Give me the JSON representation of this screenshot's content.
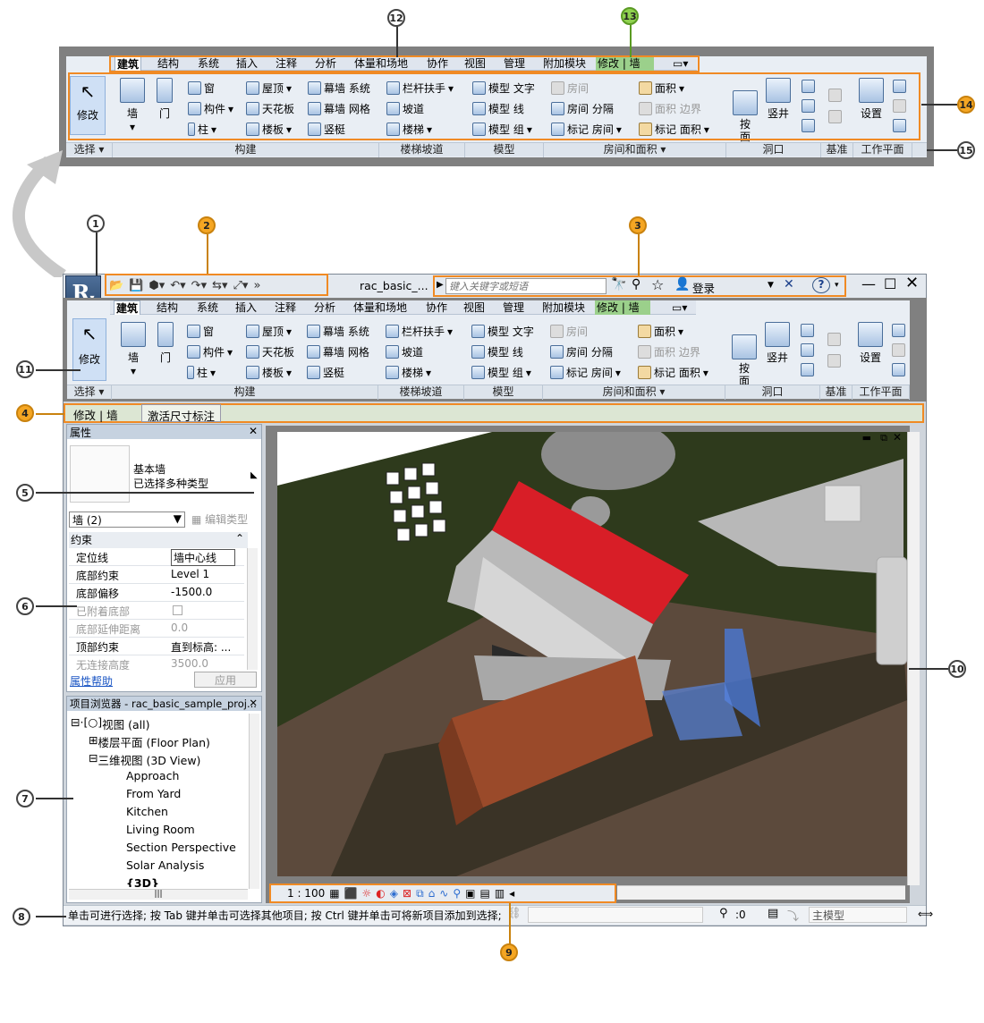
{
  "callouts": [
    "1",
    "2",
    "3",
    "4",
    "5",
    "6",
    "7",
    "8",
    "9",
    "10",
    "11",
    "12",
    "13",
    "14",
    "15"
  ],
  "ribbon": {
    "tabs": [
      "建筑",
      "结构",
      "系统",
      "插入",
      "注释",
      "分析",
      "体量和场地",
      "协作",
      "视图",
      "管理",
      "附加模块",
      "修改 | 墙"
    ],
    "tab_menu_icon": "tab-menu-icon",
    "modify": "修改",
    "build": {
      "wall": "墙",
      "door": "门",
      "window": "窗",
      "component": "构件",
      "column": "柱",
      "roof": "屋顶",
      "ceiling": "天花板",
      "floor": "楼板",
      "curtain_system": "幕墙 系统",
      "curtain_grid": "幕墙 网格",
      "mullion": "竖梃"
    },
    "stairs": {
      "railing": "栏杆扶手",
      "ramp": "坡道",
      "stair": "楼梯"
    },
    "model": {
      "text": "模型 文字",
      "line": "模型 线",
      "group": "模型 组"
    },
    "room": {
      "room": "房间",
      "room_sep": "房间 分隔",
      "tag_room": "标记 房间",
      "area": "面积",
      "area_boundary": "面积 边界",
      "tag_area": "标记 面积"
    },
    "opening": {
      "by_face": "按\n面",
      "shaft": "竖井"
    },
    "workplane": {
      "set": "设置"
    },
    "panels": {
      "select": "选择",
      "build": "构建",
      "stairs": "楼梯坡道",
      "model": "模型",
      "room": "房间和面积",
      "opening": "洞口",
      "datum": "基准",
      "workplane": "工作平面"
    }
  },
  "titlebar": {
    "filename": "rac_basic_...",
    "search_placeholder": "键入关键字或短语",
    "login": "登录",
    "help": "?"
  },
  "options_bar": {
    "context": "修改 | 墙",
    "button": "激活尺寸标注"
  },
  "properties": {
    "title": "属性",
    "type_name": "基本墙",
    "type_sub": "已选择多种类型",
    "selector": "墙 (2)",
    "edit_type": "编辑类型",
    "group": "约束",
    "rows": [
      {
        "name": "定位线",
        "value": "墙中心线",
        "dim": false
      },
      {
        "name": "底部约束",
        "value": "Level 1",
        "dim": false
      },
      {
        "name": "底部偏移",
        "value": "-1500.0",
        "dim": false
      },
      {
        "name": "已附着底部",
        "value": "",
        "dim": true
      },
      {
        "name": "底部延伸距离",
        "value": "0.0",
        "dim": true
      },
      {
        "name": "顶部约束",
        "value": "直到标高: ...",
        "dim": false
      },
      {
        "name": "无连接高度",
        "value": "3500.0",
        "dim": true
      }
    ],
    "help": "属性帮助",
    "apply": "应用"
  },
  "browser": {
    "title": "项目浏览器 - rac_basic_sample_proj...",
    "root": "视图 (all)",
    "floor": "楼层平面 (Floor Plan)",
    "view3d": "三维视图 (3D View)",
    "items": [
      "Approach",
      "From Yard",
      "Kitchen",
      "Living Room",
      "Section Perspective",
      "Solar Analysis",
      "{3D}"
    ]
  },
  "viewbar": {
    "scale": "1 : 100"
  },
  "status": {
    "message": "单击可进行选择; 按 Tab 键并单击可选择其他项目; 按 Ctrl 键并单击可将新项目添加到选择;",
    "count": ":0",
    "model": "主模型"
  },
  "colors": {
    "highlight": "#f08a24",
    "roof": "#e0202a",
    "ground": "#2e3a1c",
    "ribbon": "#e9eef4"
  }
}
